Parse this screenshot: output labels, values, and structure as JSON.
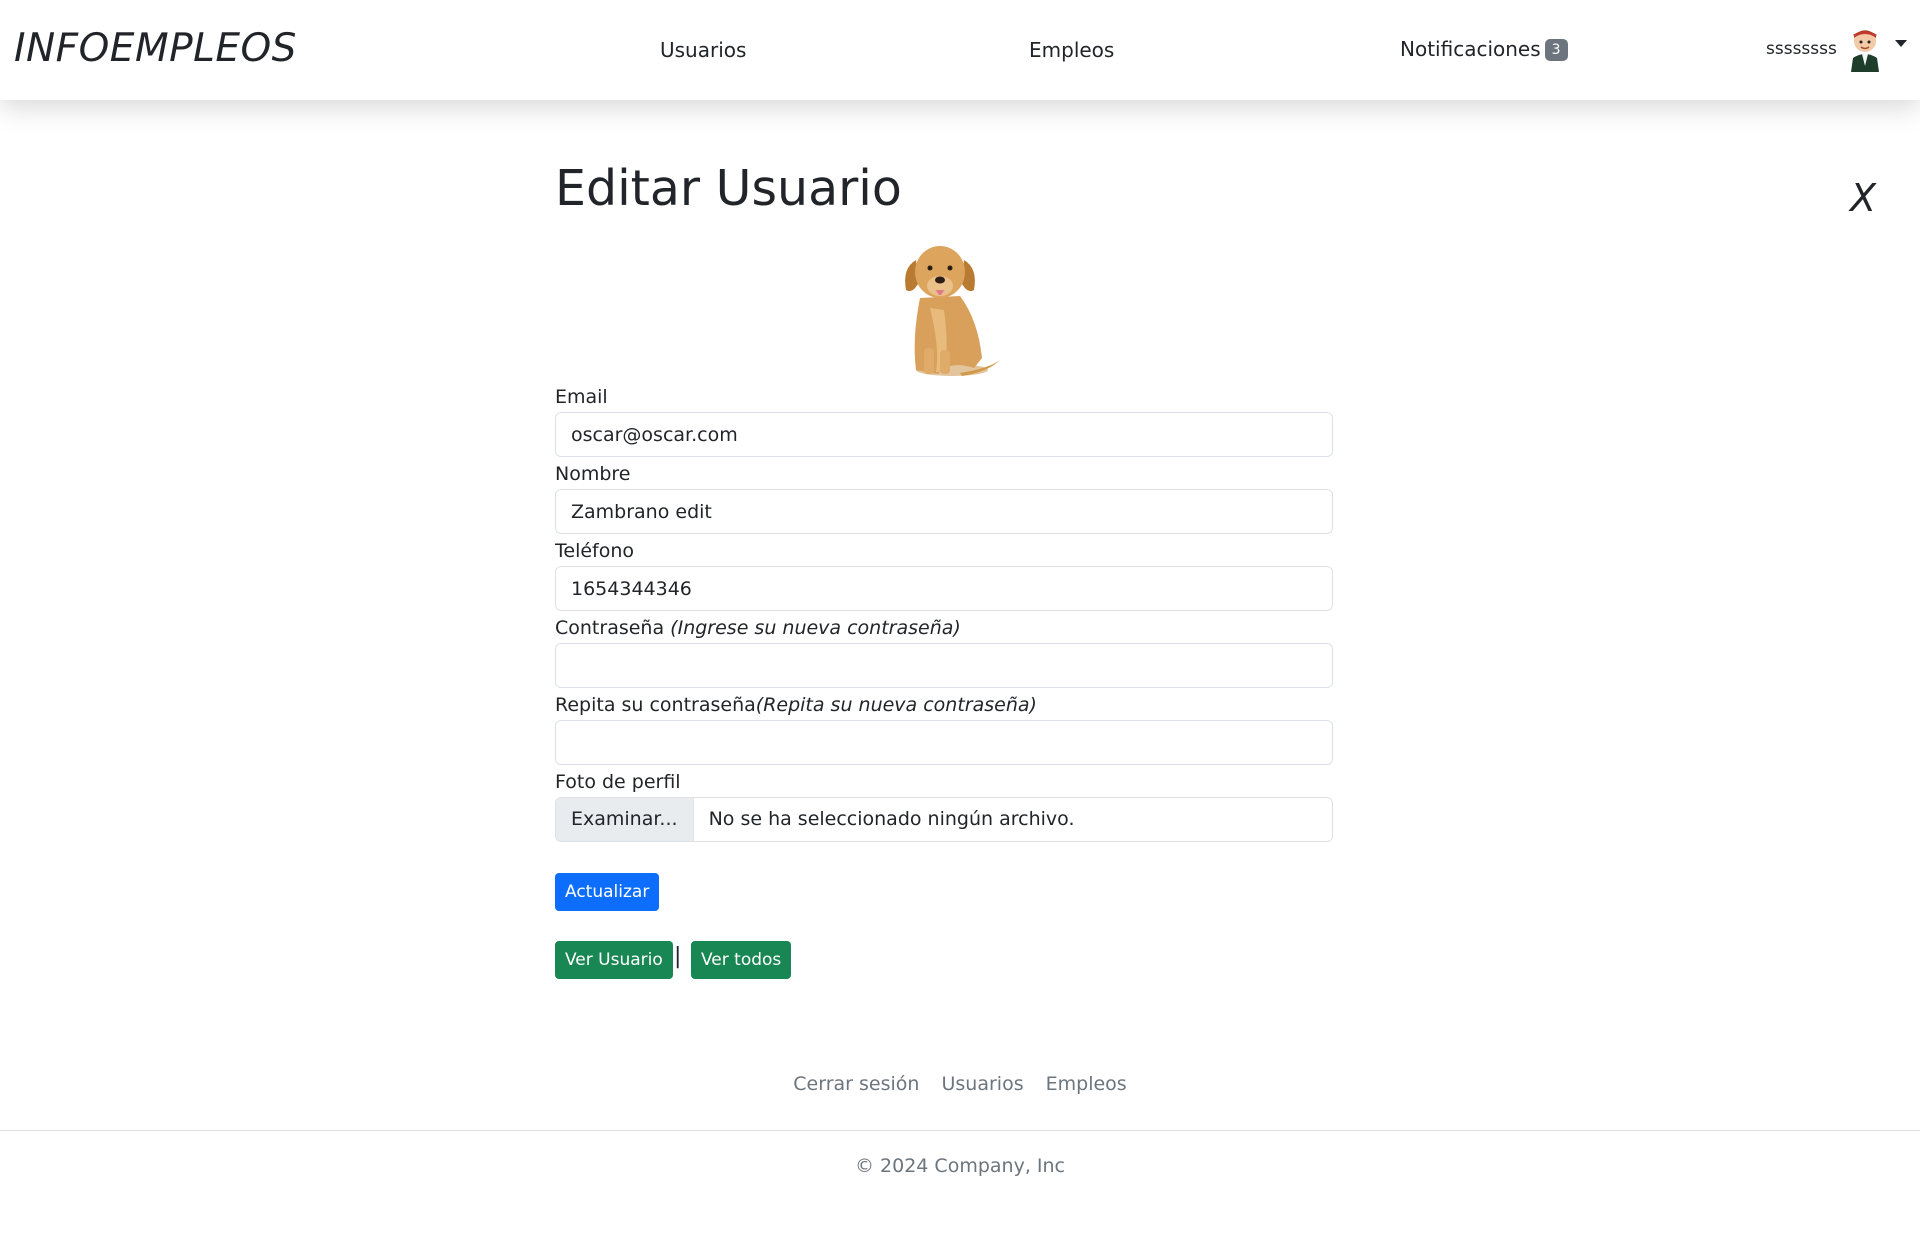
{
  "navbar": {
    "brand": "INFOEMPLEOS",
    "links": [
      "Usuarios",
      "Empleos"
    ],
    "notifications_label": "Notificaciones",
    "notifications_count": "3",
    "user_name": "ssssssss",
    "avatar_icon": "user-avatar-icon"
  },
  "main": {
    "title": "Editar Usuario",
    "close_label": "X",
    "profile_image_icon": "golden-retriever-photo",
    "fields": {
      "email": {
        "label": "Email",
        "value": "oscar@oscar.com"
      },
      "nombre": {
        "label": "Nombre",
        "value": "Zambrano edit"
      },
      "telefono": {
        "label": "Teléfono",
        "value": "1654344346"
      },
      "password": {
        "label": "Contraseña",
        "hint": "(Ingrese su nueva contraseña)",
        "value": ""
      },
      "password_repeat": {
        "label": "Repita su contraseña",
        "hint": "(Repita su nueva contraseña)",
        "value": ""
      },
      "photo": {
        "label": "Foto de perfil",
        "button": "Examinar...",
        "status": "No se ha seleccionado ningún archivo."
      }
    },
    "submit_label": "Actualizar",
    "view_user_label": "Ver Usuario",
    "separator": "|",
    "view_all_label": "Ver todos"
  },
  "footer": {
    "links": [
      "Cerrar sesión",
      "Usuarios",
      "Empleos"
    ],
    "copyright": "© 2024 Company, Inc"
  },
  "colors": {
    "primary": "#0d6efd",
    "success": "#198754",
    "badge": "#6c757d",
    "muted_text": "#6c757d"
  }
}
